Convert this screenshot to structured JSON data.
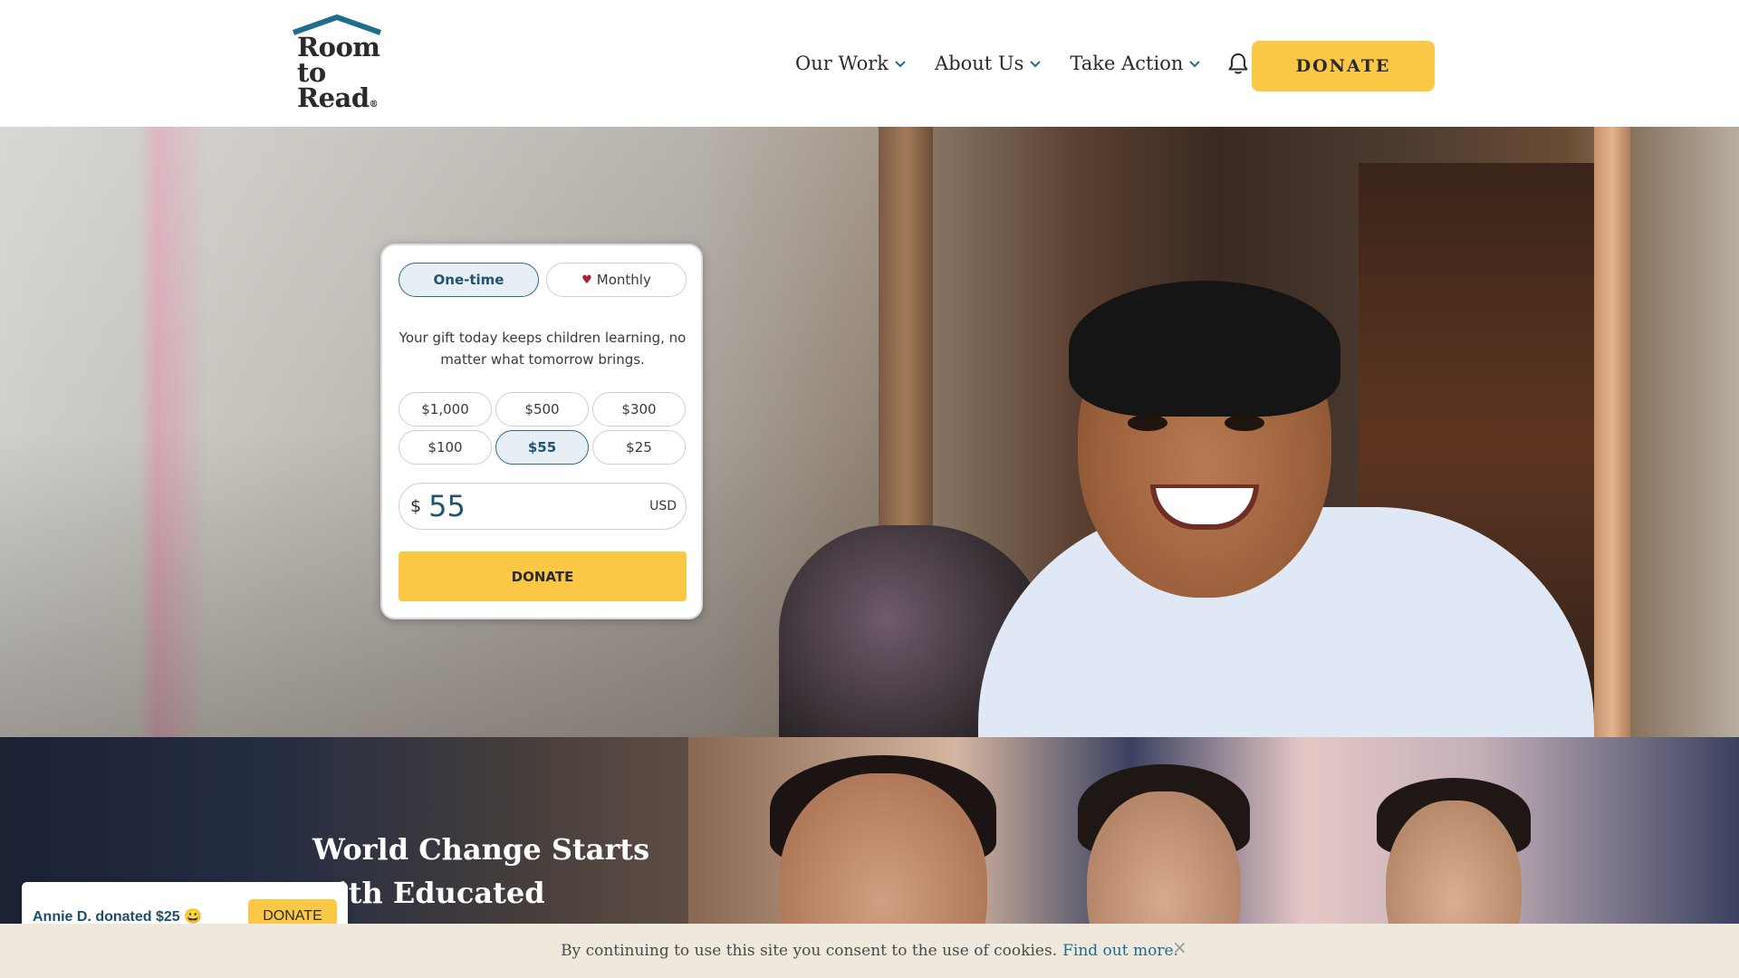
{
  "brand": {
    "logo_lines": [
      "Room",
      "to",
      "Read"
    ],
    "logo_mark": "®"
  },
  "nav": {
    "items": [
      {
        "label": "Our Work"
      },
      {
        "label": "About Us"
      },
      {
        "label": "Take Action"
      }
    ],
    "bell_icon": "bell-icon",
    "donate_label": "DONATE"
  },
  "donation_card": {
    "frequency": [
      {
        "label": "One-time",
        "selected": true
      },
      {
        "label": "Monthly",
        "icon": "heart-icon",
        "selected": false
      }
    ],
    "message": "Your gift today keeps children learning, no matter what tomorrow brings.",
    "amounts": [
      {
        "label": "$1,000",
        "selected": false
      },
      {
        "label": "$500",
        "selected": false
      },
      {
        "label": "$300",
        "selected": false
      },
      {
        "label": "$100",
        "selected": false
      },
      {
        "label": "$55",
        "selected": true
      },
      {
        "label": "$25",
        "selected": false
      }
    ],
    "currency_symbol": "$",
    "amount_value": "55",
    "currency_code": "USD",
    "donate_label": "DONATE"
  },
  "section2": {
    "title": "World Change Starts with Educated"
  },
  "toast": {
    "text": "Annie D. donated $25 😀",
    "button_label": "DONATE"
  },
  "cookie_bar": {
    "text": "By continuing to use this site you consent to the use of cookies.",
    "link_text": "Find out more.",
    "close_icon": "close-icon"
  },
  "colors": {
    "accent_yellow": "#fbc846",
    "brand_blue": "#1e6d8b",
    "selected_bg": "#e7eff5"
  }
}
